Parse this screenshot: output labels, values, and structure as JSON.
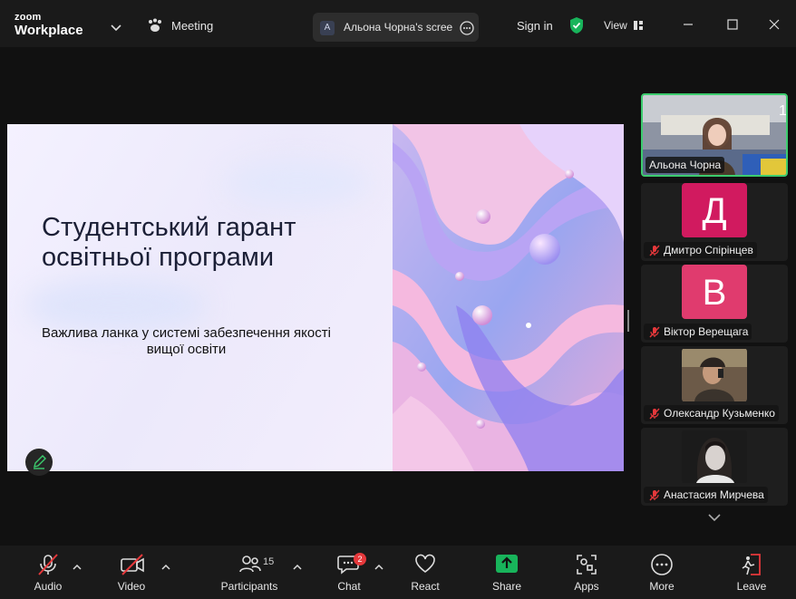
{
  "app": {
    "logo_small": "zoom",
    "logo_big": "Workplace"
  },
  "header": {
    "meeting_label": "Meeting",
    "share_badge": "A",
    "share_label": "Альона Чорна's screen",
    "signin_label": "Sign in",
    "view_label": "View"
  },
  "slide": {
    "title": "Студентський гарант освітньої програми",
    "subtitle": "Важлива ланка у системі забезпечення якості вищої освіти"
  },
  "gallery": {
    "participants": [
      {
        "name": "Альона Чорна",
        "initial": "",
        "color": "",
        "muted": false
      },
      {
        "name": "Дмитро Спірінцев",
        "initial": "Д",
        "color": "#d11a5f",
        "muted": true
      },
      {
        "name": "Віктор Верещага",
        "initial": "В",
        "color": "#e03b6e",
        "muted": true
      },
      {
        "name": "Олександр Кузьменко",
        "initial": "",
        "color": "",
        "muted": true
      },
      {
        "name": "Анастасия Мирчева",
        "initial": "",
        "color": "",
        "muted": true
      }
    ]
  },
  "toolbar": {
    "audio_label": "Audio",
    "video_label": "Video",
    "participants_label": "Participants",
    "participants_count": "15",
    "chat_label": "Chat",
    "chat_badge": "2",
    "react_label": "React",
    "share_label": "Share",
    "apps_label": "Apps",
    "more_label": "More",
    "leave_label": "Leave"
  },
  "colors": {
    "active_speaker": "#3ccc6e",
    "share_green": "#18b45b",
    "leave_red": "#e5383b",
    "badge_red": "#e5383b"
  }
}
